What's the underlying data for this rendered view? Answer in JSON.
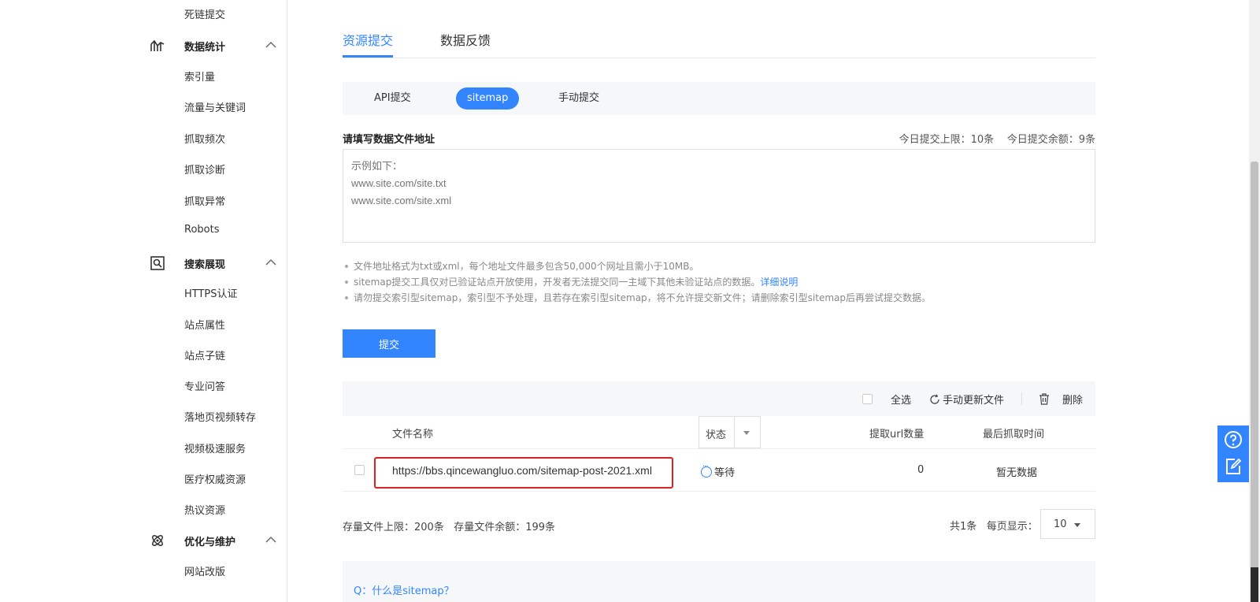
{
  "sidebar": {
    "top_item": "死链提交",
    "groups": [
      {
        "label": "数据统计",
        "items": [
          "索引量",
          "流量与关键词",
          "抓取频次",
          "抓取诊断",
          "抓取异常",
          "Robots"
        ]
      },
      {
        "label": "搜索展现",
        "items": [
          "HTTPS认证",
          "站点属性",
          "站点子链",
          "专业问答",
          "落地页视频转存",
          "视频极速服务",
          "医疗权威资源",
          "热议资源"
        ]
      },
      {
        "label": "优化与维护",
        "items": [
          "网站改版"
        ]
      }
    ]
  },
  "tabs": [
    "资源提交",
    "数据反馈"
  ],
  "subtabs": [
    "API提交",
    "sitemap",
    "手动提交"
  ],
  "form": {
    "label": "请填写数据文件地址",
    "quota_limit": "今日提交上限：10条",
    "quota_remaining": "今日提交余额：9条",
    "placeholder": "示例如下：\nwww.site.com/site.txt\nwww.site.com/site.xml",
    "submit_label": "提交"
  },
  "notes": {
    "n1": "文件地址格式为txt或xml，每个地址文件最多包含50,000个网址且需小于10MB。",
    "n2": "sitemap提交工具仅对已验证站点开放使用，开发者无法提交同一主域下其他未验证站点的数据。",
    "n2_link": "详细说明",
    "n3": "请勿提交索引型sitemap，索引型不予处理，且若存在索引型sitemap，将不允许提交新文件；请删除索引型sitemap后再尝试提交数据。"
  },
  "toolbar": {
    "select_all": "全选",
    "manual_update": "手动更新文件",
    "delete": "删除"
  },
  "table": {
    "headers": {
      "file_name": "文件名称",
      "status": "状态",
      "url_count": "提取url数量",
      "last_crawl": "最后抓取时间"
    },
    "rows": [
      {
        "file": "https://bbs.qincewangluo.com/sitemap-post-2021.xml",
        "status": "等待",
        "count": "0",
        "last": "暂无数据"
      }
    ]
  },
  "footer": {
    "stock_limit": "存量文件上限：200条",
    "stock_remaining": "存量文件余额：199条",
    "total": "共1条",
    "per_page_label": "每页显示：",
    "per_page_value": "10"
  },
  "faq": {
    "q1": "Q：什么是sitemap？"
  },
  "colors": {
    "accent": "#3385ff",
    "highlight_border": "#e02020"
  },
  "icons": [
    "chart-icon",
    "search-display-icon",
    "atom-icon",
    "chevron-up-icon",
    "refresh-icon",
    "trash-icon",
    "help-icon",
    "feedback-icon"
  ]
}
